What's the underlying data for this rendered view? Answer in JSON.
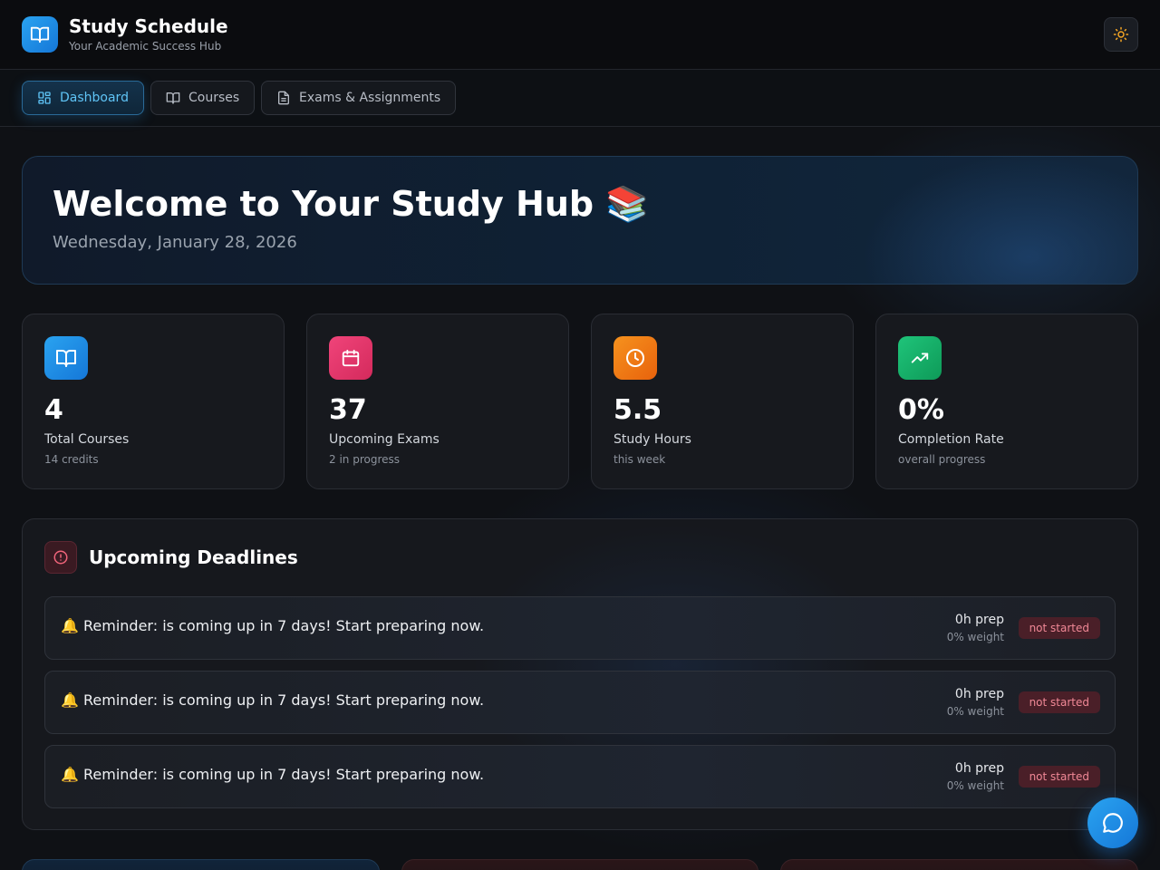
{
  "header": {
    "title": "Study Schedule",
    "subtitle": "Your Academic Success Hub",
    "logo_icon": "open-book-icon",
    "theme_icon": "sun-icon"
  },
  "nav": {
    "tabs": [
      {
        "label": "Dashboard",
        "icon": "dashboard-icon",
        "active": true
      },
      {
        "label": "Courses",
        "icon": "book-icon",
        "active": false
      },
      {
        "label": "Exams & Assignments",
        "icon": "document-icon",
        "active": false
      }
    ]
  },
  "hero": {
    "title": "Welcome to Your Study Hub 📚",
    "date": "Wednesday, January 28, 2026"
  },
  "stats": [
    {
      "value": "4",
      "label": "Total Courses",
      "sub": "14 credits",
      "icon": "book-icon",
      "color": "#1e90e8"
    },
    {
      "value": "37",
      "label": "Upcoming Exams",
      "sub": "2 in progress",
      "icon": "calendar-icon",
      "color": "#e8336a"
    },
    {
      "value": "5.5",
      "label": "Study Hours",
      "sub": "this week",
      "icon": "clock-icon",
      "color": "#f07a14"
    },
    {
      "value": "0%",
      "label": "Completion Rate",
      "sub": "overall progress",
      "icon": "trending-up-icon",
      "color": "#14b06a"
    }
  ],
  "deadlines": {
    "title": "Upcoming Deadlines",
    "icon": "alert-icon",
    "items": [
      {
        "message": "🔔 Reminder:  is coming up in 7 days! Start preparing now.",
        "prep": "0h prep",
        "weight": "0% weight",
        "status": "not started"
      },
      {
        "message": "🔔 Reminder:  is coming up in 7 days! Start preparing now.",
        "prep": "0h prep",
        "weight": "0% weight",
        "status": "not started"
      },
      {
        "message": "🔔 Reminder:  is coming up in 7 days! Start preparing now.",
        "prep": "0h prep",
        "weight": "0% weight",
        "status": "not started"
      }
    ]
  },
  "chat": {
    "icon": "chat-bubble-icon"
  }
}
